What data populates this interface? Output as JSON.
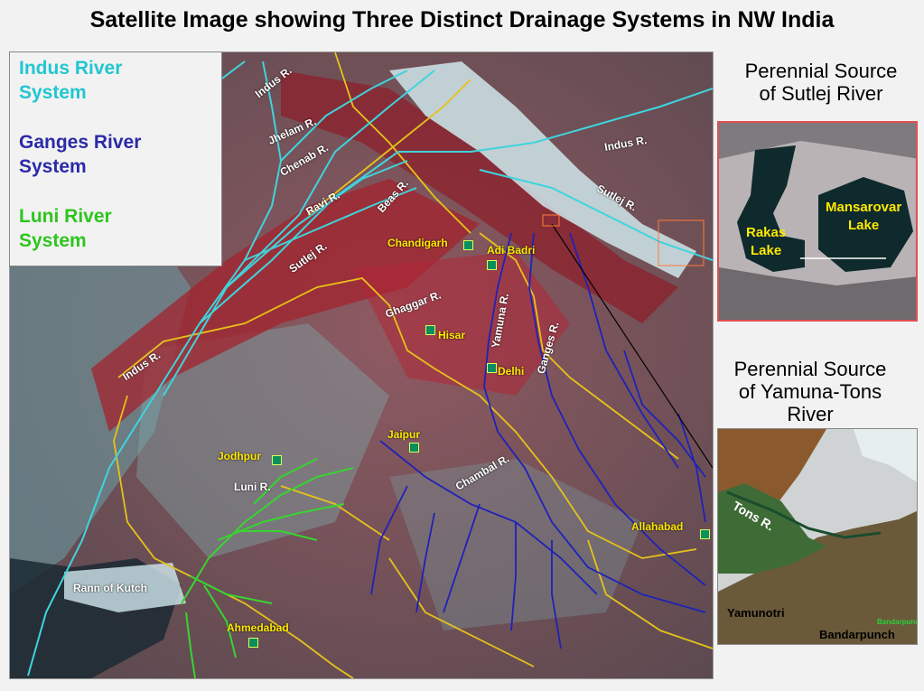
{
  "title": "Satellite Image showing Three Distinct Drainage Systems in NW India",
  "legend": [
    {
      "label": "Indus River\nSystem",
      "color": "#22c6d0"
    },
    {
      "label": "Ganges River\nSystem",
      "color": "#2b2aa8"
    },
    {
      "label": "Luni River\nSystem",
      "color": "#2ec51d"
    }
  ],
  "colors": {
    "boundary": "#e6c21a",
    "indus": "#3fd4dc",
    "ganges": "#1e22b8",
    "luni": "#38d430",
    "city_label": "#ffe800"
  },
  "rivers": {
    "indus_upper": "Indus R.",
    "jhelam": "Jhelam R.",
    "chenab": "Chenab R.",
    "ravi": "Ravi R.",
    "beas": "Beas R.",
    "sutlej_lower": "Sutlej R.",
    "indus_mid": "Indus R.",
    "sutlej_upper": "Sutlej R.",
    "indus_lower": "Indus R.",
    "ghaggar": "Ghaggar R.",
    "yamuna": "Yamuna R.",
    "ganges": "Ganges R.",
    "chambal": "Chambal R.",
    "luni": "Luni R.",
    "rann": "Rann of Kutch"
  },
  "cities": {
    "chandigarh": "Chandigarh",
    "adi_badri": "Adi Badri",
    "hisar": "Hisar",
    "delhi": "Delhi",
    "jaipur": "Jaipur",
    "jodhpur": "Jodhpur",
    "allahabad": "Allahabad",
    "ahmedabad": "Ahmedabad"
  },
  "sutlej_panel": {
    "caption": "Perennial Source\nof Sutlej River",
    "lake_left": "Rakas\nLake",
    "lake_right": "Mansarovar\nLake"
  },
  "yamuna_panel": {
    "caption": "Perennial Source\nof Yamuna-Tons\nRiver",
    "tons": "Tons R.",
    "yamunotri": "Yamunotri",
    "bandarpunch": "Bandarpunch",
    "bandarpunch_small": "Bandarpunch"
  }
}
